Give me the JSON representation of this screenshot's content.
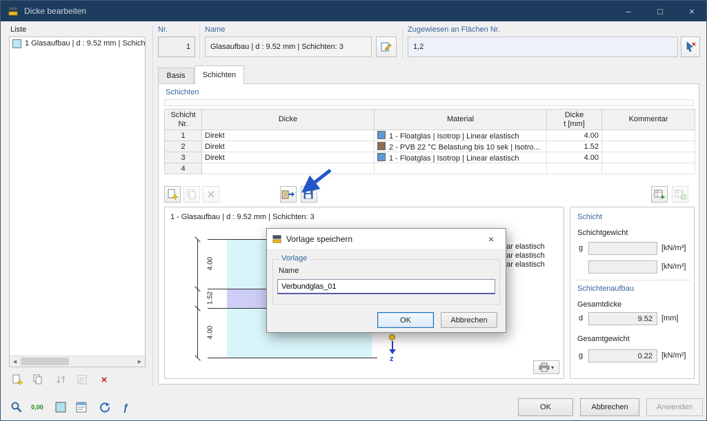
{
  "titlebar": {
    "title": "Dicke bearbeiten"
  },
  "icons": {
    "minimize": "–",
    "maximize": "□",
    "close": "×",
    "scroll_left": "◀",
    "scroll_right": "▶",
    "delete": "×",
    "dropdown": "▾"
  },
  "list_panel": {
    "label": "Liste",
    "item": {
      "text": "1  Glasaufbau | d : 9.52 mm | Schich",
      "color": "#b5e8f2"
    }
  },
  "header": {
    "nr_label": "Nr.",
    "nr_value": "1",
    "name_label": "Name",
    "name_value": "Glasaufbau | d : 9.52 mm | Schichten: 3",
    "assigned_label": "Zugewiesen an Flächen Nr.",
    "assigned_value": "1,2"
  },
  "tabs": {
    "basis": "Basis",
    "schichten": "Schichten"
  },
  "layers": {
    "section_title": "Schichten",
    "headers": {
      "nr": "Schicht\nNr.",
      "dicke": "Dicke",
      "material": "Material",
      "t": "Dicke\nt [mm]",
      "kommentar": "Kommentar"
    },
    "rows": [
      {
        "nr": "1",
        "dicke": "Direkt",
        "material": "1 - Floatglas | Isotrop | Linear elastisch",
        "color": "#5b9bd5",
        "t": "4.00",
        "kommentar": ""
      },
      {
        "nr": "2",
        "dicke": "Direkt",
        "material": "2 - PVB 22 °C Belastung bis 10 sek | Isotro...",
        "color": "#8b6f55",
        "t": "1.52",
        "kommentar": ""
      },
      {
        "nr": "3",
        "dicke": "Direkt",
        "material": "1 - Floatglas | Isotrop | Linear elastisch",
        "color": "#5b9bd5",
        "t": "4.00",
        "kommentar": ""
      },
      {
        "nr": "4",
        "dicke": "",
        "material": "",
        "t": "",
        "kommentar": ""
      }
    ]
  },
  "preview": {
    "title": "1 - Glasaufbau | d : 9.52 mm | Schichten: 3",
    "dim_labels": [
      "4.00",
      "1.52",
      "4.00"
    ],
    "layer_colors": [
      "#d8f6fa",
      "#cdcdf5",
      "#d8f6fa"
    ],
    "axis_label": "z",
    "legend_fragments": [
      "ear elastisch",
      "ear elastisch",
      "ear elastisch"
    ]
  },
  "side": {
    "schicht_title": "Schicht",
    "schichtgewicht_label": "Schichtgewicht",
    "g_label": "g",
    "g1_value": "",
    "g1_unit": "[kN/m³]",
    "g2_value": "",
    "g2_unit": "[kN/m²]",
    "aufbau_title": "Schichtenaufbau",
    "gesamtdicke_label": "Gesamtdicke",
    "d_label": "d",
    "d_value": "9.52",
    "d_unit": "[mm]",
    "gesamtgewicht_label": "Gesamtgewicht",
    "gw_label": "g",
    "gw_value": "0.22",
    "gw_unit": "[kN/m²]"
  },
  "modal": {
    "title": "Vorlage speichern",
    "group_label": "Vorlage",
    "name_label": "Name",
    "name_value": "Verbundglas_01",
    "ok": "OK",
    "cancel": "Abbrechen"
  },
  "footer": {
    "ok": "OK",
    "cancel": "Abbrechen",
    "apply": "Anwenden",
    "units_label": "0,00"
  }
}
